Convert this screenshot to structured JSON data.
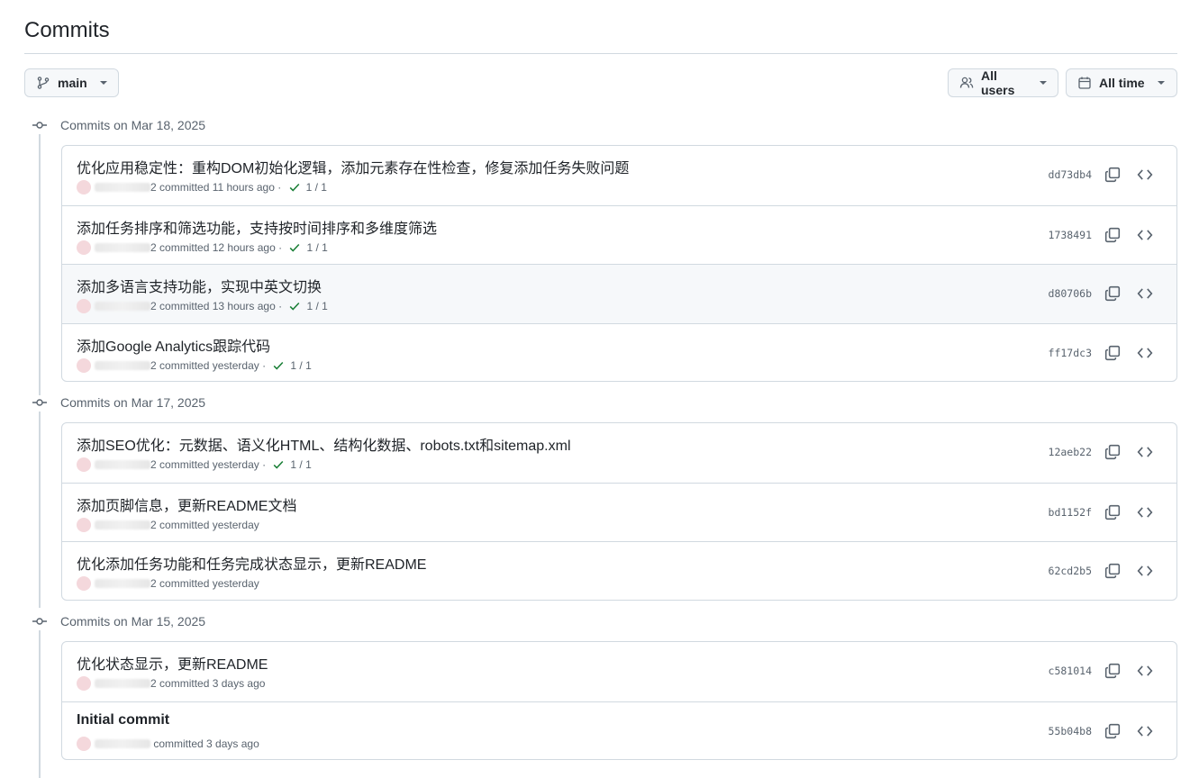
{
  "page": {
    "title": "Commits"
  },
  "toolbar": {
    "branch_label": "main",
    "users_label": "All users",
    "time_label": "All time"
  },
  "groups": [
    {
      "date_label": "Commits on Mar 18, 2025",
      "commits": [
        {
          "message": "优化应用稳定性：重构DOM初始化逻辑，添加元素存在性检查，修复添加任务失败问题",
          "author_suffix": "2",
          "time": "committed 11 hours ago",
          "checks": "1 / 1",
          "sha": "dd73db4"
        },
        {
          "message": "添加任务排序和筛选功能，支持按时间排序和多维度筛选",
          "author_suffix": "2",
          "time": "committed 12 hours ago",
          "checks": "1 / 1",
          "sha": "1738491"
        },
        {
          "message": "添加多语言支持功能，实现中英文切换",
          "author_suffix": "2",
          "time": "committed 13 hours ago",
          "checks": "1 / 1",
          "sha": "d80706b"
        },
        {
          "message": "添加Google Analytics跟踪代码",
          "author_suffix": "2",
          "time": "committed yesterday",
          "checks": "1 / 1",
          "sha": "ff17dc3"
        }
      ]
    },
    {
      "date_label": "Commits on Mar 17, 2025",
      "commits": [
        {
          "message": "添加SEO优化：元数据、语义化HTML、结构化数据、robots.txt和sitemap.xml",
          "author_suffix": "2",
          "time": "committed yesterday",
          "checks": "1 / 1",
          "sha": "12aeb22"
        },
        {
          "message": "添加页脚信息，更新README文档",
          "author_suffix": "2",
          "time": "committed yesterday",
          "checks": "",
          "sha": "bd1152f"
        },
        {
          "message": "优化添加任务功能和任务完成状态显示，更新README",
          "author_suffix": "2",
          "time": "committed yesterday",
          "checks": "",
          "sha": "62cd2b5"
        }
      ]
    },
    {
      "date_label": "Commits on Mar 15, 2025",
      "commits": [
        {
          "message": "优化状态显示，更新README",
          "author_suffix": "2",
          "time": "committed 3 days ago",
          "checks": "",
          "sha": "c581014"
        },
        {
          "message": "Initial commit",
          "author_suffix": "",
          "time": "committed 3 days ago",
          "checks": "",
          "sha": "55b04b8"
        }
      ]
    }
  ]
}
